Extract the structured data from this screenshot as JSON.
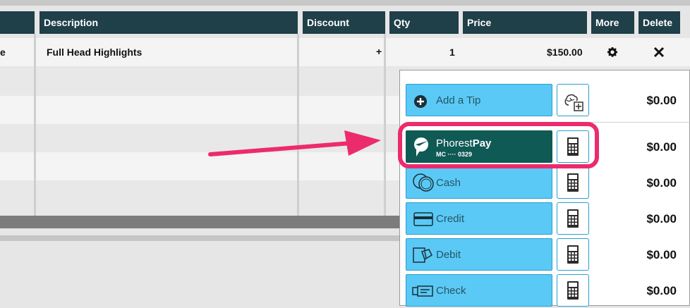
{
  "table": {
    "headers": [
      "Description",
      "Discount",
      "Qty",
      "Price",
      "More",
      "Delete"
    ],
    "row": {
      "leading_fragment": "e",
      "description": "Full Head Highlights",
      "discount": "+",
      "qty": "1",
      "price": "$150.00"
    }
  },
  "payments": {
    "tip": {
      "label": "Add a Tip",
      "amount": "$0.00"
    },
    "phorest_pay": {
      "brand_light": "Phorest",
      "brand_bold": "Pay",
      "card": "MC ···· 0329",
      "amount": "$0.00"
    },
    "cash": {
      "label": "Cash",
      "amount": "$0.00"
    },
    "credit": {
      "label": "Credit",
      "amount": "$0.00"
    },
    "debit": {
      "label": "Debit",
      "amount": "$0.00"
    },
    "check": {
      "label": "Check",
      "amount": "$0.00"
    }
  },
  "colors": {
    "header_bg": "#1f3f49",
    "button_bg": "#5bc9f5",
    "phorest_bg": "#0f5a55",
    "highlight": "#ec2b6d"
  }
}
